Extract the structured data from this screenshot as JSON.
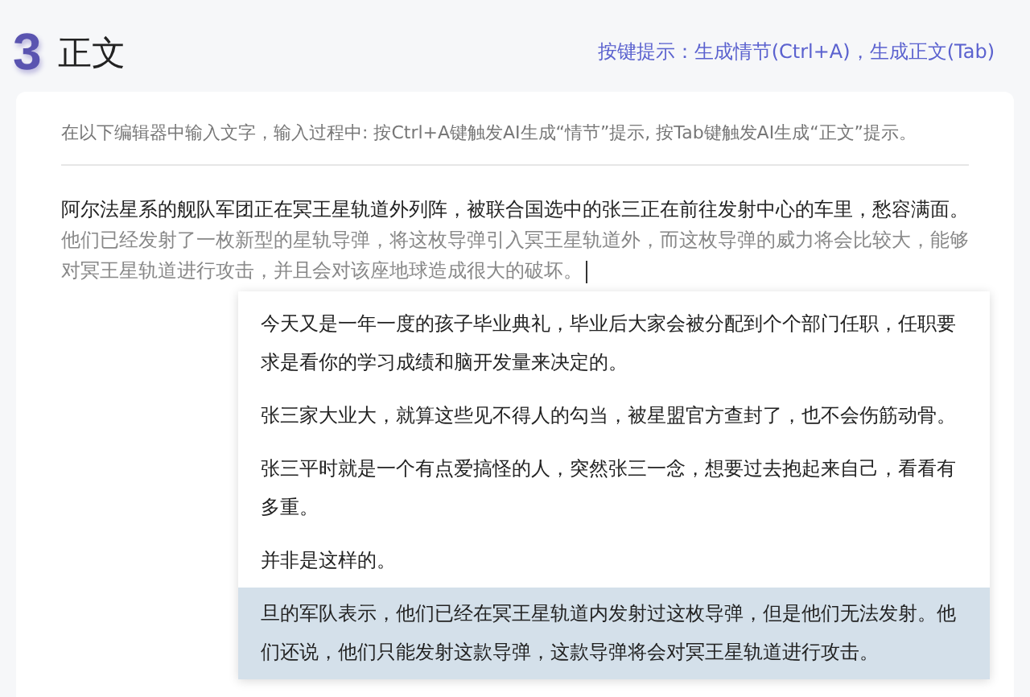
{
  "header": {
    "step": "3",
    "title": "正文",
    "hint": "按键提示：生成情节(Ctrl+A)，生成正文(Tab)"
  },
  "instructions": "在以下编辑器中输入文字，输入过程中: 按Ctrl+A键触发AI生成“情节”提示, 按Tab键触发AI生成“正文”提示。",
  "editor": {
    "text": "阿尔法星系的舰队军团正在冥王星轨道外列阵，被联合国选中的张三正在前往发射中心的车里，愁容满面。",
    "suggestion": "他们已经发射了一枚新型的星轨导弹，将这枚导弹引入冥王星轨道外，而这枚导弹的威力将会比较大，能够对冥王星轨道进行攻击，并且会对该座地球造成很大的破坏。"
  },
  "suggestions": [
    {
      "text": "今天又是一年一度的孩子毕业典礼，毕业后大家会被分配到个个部门任职，任职要求是看你的学习成绩和脑开发量来决定的。",
      "selected": false
    },
    {
      "text": "张三家大业大，就算这些见不得人的勾当，被星盟官方查封了，也不会伤筋动骨。",
      "selected": false
    },
    {
      "text": "张三平时就是一个有点爱搞怪的人，突然张三一念，想要过去抱起来自己，看看有多重。",
      "selected": false
    },
    {
      "text": "并非是这样的。",
      "selected": false
    },
    {
      "text": "旦的军队表示，他们已经在冥王星轨道内发射过这枚导弹，但是他们无法发射。他们还说，他们只能发射这款导弹，这款导弹将会对冥王星轨道进行攻击。",
      "selected": true
    }
  ]
}
